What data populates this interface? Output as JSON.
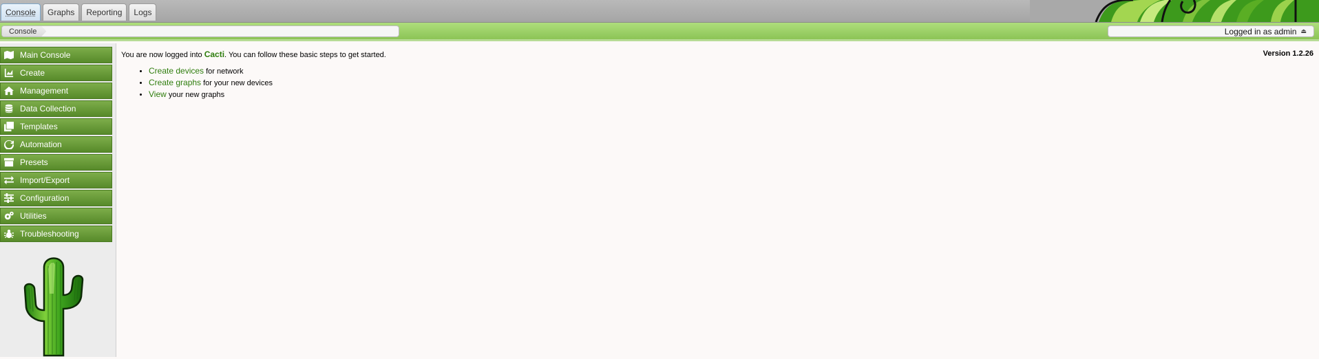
{
  "tabs": [
    {
      "label": "Console",
      "active": true
    },
    {
      "label": "Graphs"
    },
    {
      "label": "Reporting"
    },
    {
      "label": "Logs"
    }
  ],
  "breadcrumb": {
    "current": "Console"
  },
  "user": {
    "label": "Logged in as admin",
    "icon": "eject-icon"
  },
  "sidebar": {
    "items": [
      {
        "label": "Main Console",
        "icon": "map-icon"
      },
      {
        "label": "Create",
        "icon": "chart-icon"
      },
      {
        "label": "Management",
        "icon": "home-icon"
      },
      {
        "label": "Data Collection",
        "icon": "database-icon"
      },
      {
        "label": "Templates",
        "icon": "copy-icon"
      },
      {
        "label": "Automation",
        "icon": "refresh-icon"
      },
      {
        "label": "Presets",
        "icon": "archive-icon"
      },
      {
        "label": "Import/Export",
        "icon": "exchange-icon"
      },
      {
        "label": "Configuration",
        "icon": "sliders-icon"
      },
      {
        "label": "Utilities",
        "icon": "cogs-icon"
      },
      {
        "label": "Troubleshooting",
        "icon": "bug-icon"
      }
    ]
  },
  "main": {
    "intro_prefix": "You are now logged into ",
    "brand": "Cacti",
    "intro_suffix": ". You can follow these basic steps to get started.",
    "version": "Version 1.2.26",
    "steps": [
      {
        "link": "Create devices",
        "text": " for network"
      },
      {
        "link": "Create graphs",
        "text": " for your new devices"
      },
      {
        "link": "View",
        "text": " your new graphs"
      }
    ]
  },
  "colors": {
    "accent": "#2e7d0d",
    "menu": "#6a9c3a",
    "navbar": "#9ed06a"
  }
}
